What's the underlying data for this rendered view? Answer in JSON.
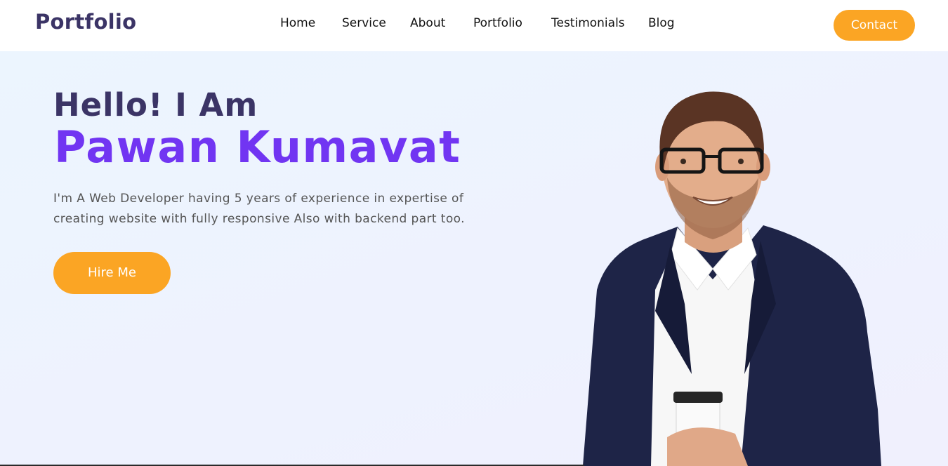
{
  "brand": {
    "logo_text": "Portfolio"
  },
  "nav": {
    "items": [
      {
        "label": "Home"
      },
      {
        "label": "Service"
      },
      {
        "label": "About"
      },
      {
        "label": "Portfolio"
      },
      {
        "label": "Testimonials"
      },
      {
        "label": "Blog"
      }
    ],
    "contact_label": "Contact"
  },
  "hero": {
    "greeting": "Hello! I Am",
    "name": "Pawan Kumavat",
    "description": "I'm A Web Developer having 5 years of experience in expertise of creating website with fully responsive Also with backend part too.",
    "cta_label": "Hire Me"
  },
  "icons": {
    "portrait": "person-photo"
  },
  "colors": {
    "accent": "#fba524",
    "brand_dark": "#3b3466",
    "name_purple": "#7135f2",
    "hero_bg": "#eef2fe"
  }
}
